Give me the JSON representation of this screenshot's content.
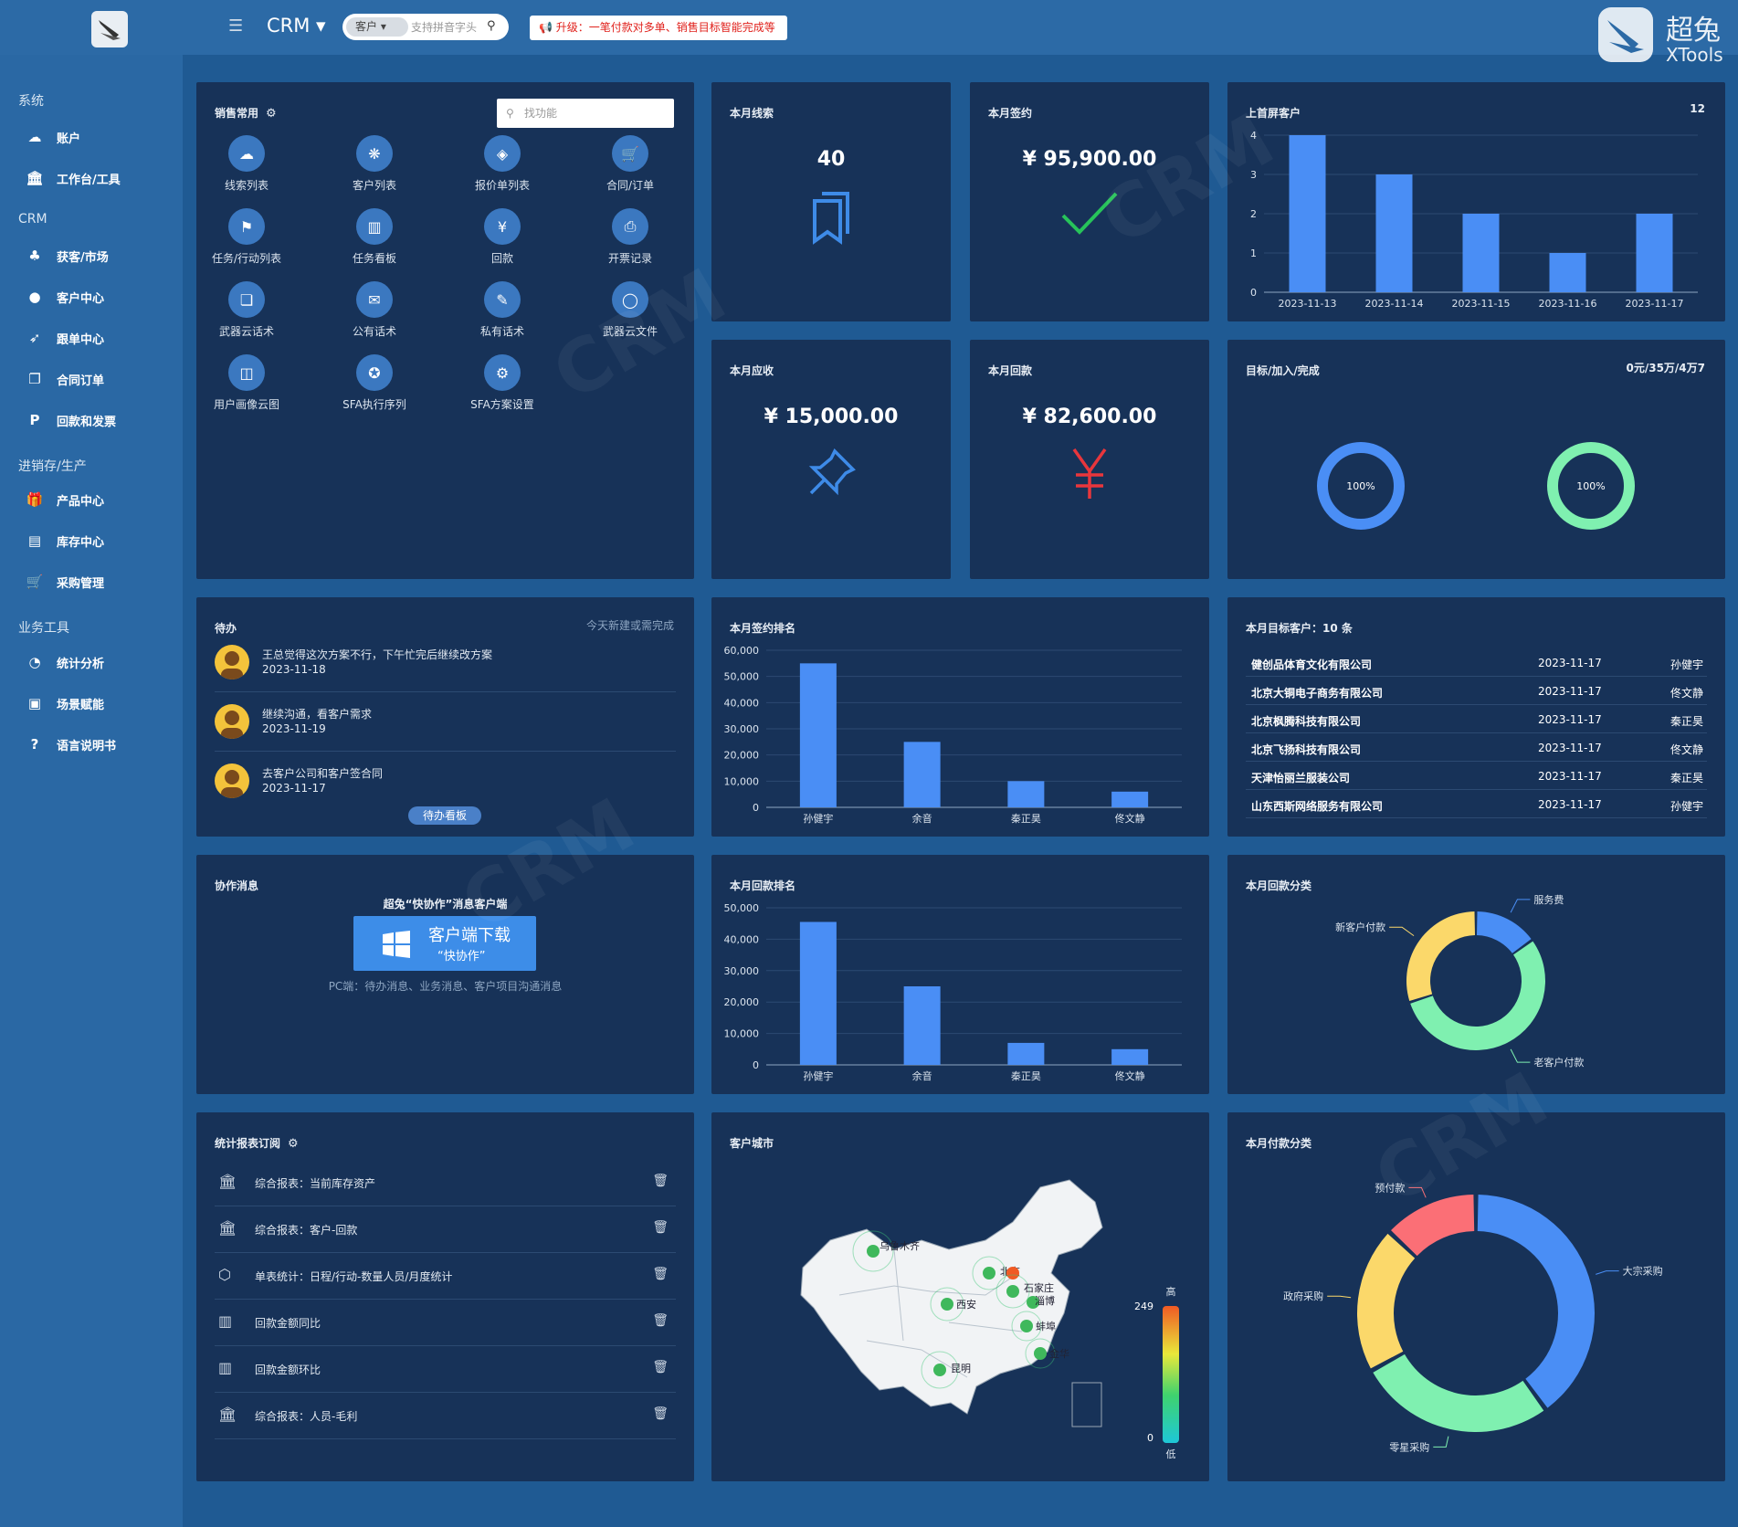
{
  "topbar": {
    "app_title": "CRM ▾",
    "search_scope": "客户 ▾",
    "search_placeholder": "支持拼音字头",
    "promo_text": "📢 升级：一笔付款对多单、销售目标智能完成等",
    "brand_cn": "超兔",
    "brand_en": "XTools"
  },
  "sidebar": {
    "sections": [
      {
        "title": "系统",
        "items": [
          {
            "label": "账户",
            "icon": "cloud-icon"
          },
          {
            "label": "工作台/工具",
            "icon": "bank-icon"
          }
        ]
      },
      {
        "title": "CRM",
        "items": [
          {
            "label": "获客/市场",
            "icon": "tree-icon"
          },
          {
            "label": "客户中心",
            "icon": "user-icon"
          },
          {
            "label": "跟单中心",
            "icon": "rocket-icon"
          },
          {
            "label": "合同订单",
            "icon": "copy-icon"
          },
          {
            "label": "回款和发票",
            "icon": "parking-icon"
          }
        ]
      },
      {
        "title": "进销存/生产",
        "items": [
          {
            "label": "产品中心",
            "icon": "gift-icon"
          },
          {
            "label": "库存中心",
            "icon": "warehouse-icon"
          },
          {
            "label": "采购管理",
            "icon": "cart-icon"
          }
        ]
      },
      {
        "title": "业务工具",
        "items": [
          {
            "label": "统计分析",
            "icon": "pie-icon"
          },
          {
            "label": "场景赋能",
            "icon": "scene-icon"
          },
          {
            "label": "语言说明书",
            "icon": "help-icon"
          }
        ]
      }
    ]
  },
  "sales_common": {
    "title": "销售常用",
    "search_placeholder": "找功能",
    "items": [
      {
        "label": "线索列表",
        "icon": "cloud-search-icon"
      },
      {
        "label": "客户列表",
        "icon": "group-icon"
      },
      {
        "label": "报价单列表",
        "icon": "tag-icon"
      },
      {
        "label": "合同/订单",
        "icon": "cart-icon"
      },
      {
        "label": "任务/行动列表",
        "icon": "flag-icon"
      },
      {
        "label": "任务看板",
        "icon": "board-icon"
      },
      {
        "label": "回款",
        "icon": "yen-icon"
      },
      {
        "label": "开票记录",
        "icon": "printer-icon"
      },
      {
        "label": "武器云话术",
        "icon": "bookmark-icon"
      },
      {
        "label": "公有话术",
        "icon": "chat-icon"
      },
      {
        "label": "私有话术",
        "icon": "chat-lock-icon"
      },
      {
        "label": "武器云文件",
        "icon": "bubble-icon"
      },
      {
        "label": "用户画像云图",
        "icon": "book-icon"
      },
      {
        "label": "SFA执行序列",
        "icon": "person-icon"
      },
      {
        "label": "SFA方案设置",
        "icon": "gear-icon"
      }
    ]
  },
  "kpis": {
    "leads": {
      "title": "本月线索",
      "value": "40"
    },
    "signed": {
      "title": "本月签约",
      "value": "¥ 95,900.00"
    },
    "receivable": {
      "title": "本月应收",
      "value": "¥ 15,000.00"
    },
    "received": {
      "title": "本月回款",
      "value": "¥ 82,600.00"
    }
  },
  "new_customers": {
    "title": "上首屏客户",
    "count": "12",
    "chart_data": {
      "type": "bar",
      "categories": [
        "2023-11-13",
        "2023-11-14",
        "2023-11-15",
        "2023-11-16",
        "2023-11-17"
      ],
      "values": [
        4,
        3,
        2,
        1,
        2
      ],
      "ylim": [
        0,
        4
      ],
      "yticks": [
        "0",
        "1",
        "2",
        "3",
        "4"
      ]
    }
  },
  "targets": {
    "title": "目标/加入/完成",
    "summary": "0元/35万/4万7",
    "ring1": {
      "label": "100%",
      "value": 100,
      "color": "#4a8ef5"
    },
    "ring2": {
      "label": "100%",
      "value": 100,
      "color": "#7ff0b0"
    }
  },
  "todo": {
    "title": "待办",
    "hint": "今天新建或需完成",
    "items": [
      {
        "text": "王总觉得这次方案不行，下午忙完后继续改方案",
        "date": "2023-11-18"
      },
      {
        "text": "继续沟通，看客户需求",
        "date": "2023-11-19"
      },
      {
        "text": "去客户公司和客户签合同",
        "date": "2023-11-17"
      }
    ],
    "button": "待办看板"
  },
  "sign_rank": {
    "title": "本月签约排名",
    "chart_data": {
      "type": "bar",
      "categories": [
        "孙健宇",
        "余音",
        "秦正昊",
        "佟文静"
      ],
      "values": [
        55000,
        25000,
        10000,
        6000
      ],
      "ylim": [
        0,
        60000
      ],
      "yticks": [
        "0",
        "10,000",
        "20,000",
        "30,000",
        "40,000",
        "50,000",
        "60,000"
      ]
    }
  },
  "target_customers": {
    "title": "本月目标客户：10 条",
    "rows": [
      {
        "name": "健创品体育文化有限公司",
        "date": "2023-11-17",
        "owner": "孙健宇"
      },
      {
        "name": "北京大铜电子商务有限公司",
        "date": "2023-11-17",
        "owner": "佟文静"
      },
      {
        "name": "北京枫腾科技有限公司",
        "date": "2023-11-17",
        "owner": "秦正昊"
      },
      {
        "name": "北京飞扬科技有限公司",
        "date": "2023-11-17",
        "owner": "佟文静"
      },
      {
        "name": "天津怡丽兰服装公司",
        "date": "2023-11-17",
        "owner": "秦正昊"
      },
      {
        "name": "山东西斯网络服务有限公司",
        "date": "2023-11-17",
        "owner": "孙健宇"
      }
    ]
  },
  "collab": {
    "title": "协作消息",
    "heading": "超兔“快协作”消息客户端",
    "btn_line1": "客户端下载",
    "btn_line2": "“快协作”",
    "desc": "PC端：待办消息、业务消息、客户项目沟通消息"
  },
  "payment_rank": {
    "title": "本月回款排名",
    "chart_data": {
      "type": "bar",
      "categories": [
        "孙健宇",
        "余音",
        "秦正昊",
        "佟文静"
      ],
      "values": [
        45500,
        25000,
        7000,
        5000
      ],
      "ylim": [
        0,
        50000
      ],
      "yticks": [
        "0",
        "10,000",
        "20,000",
        "30,000",
        "40,000",
        "50,000"
      ]
    }
  },
  "payment_category": {
    "title": "本月回款分类",
    "chart_data": {
      "type": "pie",
      "labels": [
        "服务费",
        "老客户付款",
        "新客户付款"
      ],
      "values": [
        15,
        55,
        30
      ],
      "colors": [
        "#4a8ef5",
        "#7ff0b0",
        "#fbd86a"
      ]
    }
  },
  "reports": {
    "title": "统计报表订阅",
    "items": [
      {
        "label": "综合报表：当前库存资产",
        "icon": "bank-icon"
      },
      {
        "label": "综合报表：客户-回款",
        "icon": "bank-icon"
      },
      {
        "label": "单表统计：日程/行动-数量人员/月度统计",
        "icon": "cube-icon"
      },
      {
        "label": "回款金额同比",
        "icon": "bar-chart-icon"
      },
      {
        "label": "回款金额环比",
        "icon": "bar-chart-icon"
      },
      {
        "label": "综合报表：人员-毛利",
        "icon": "bank-icon"
      }
    ]
  },
  "customer_city": {
    "title": "客户城市",
    "legend_max": "249",
    "legend_min": "0",
    "legend_high": "高",
    "legend_low": "低",
    "cities": [
      {
        "name": "乌鲁木齐"
      },
      {
        "name": "西安"
      },
      {
        "name": "北京"
      },
      {
        "name": "石家庄"
      },
      {
        "name": "淄博"
      },
      {
        "name": "蚌埠"
      },
      {
        "name": "金华"
      },
      {
        "name": "昆明"
      }
    ]
  },
  "pay_type": {
    "title": "本月付款分类",
    "chart_data": {
      "type": "pie",
      "labels": [
        "大宗采购",
        "零星采购",
        "政府采购",
        "预付款"
      ],
      "values": [
        40,
        27,
        20,
        13
      ],
      "colors": [
        "#4a8ef5",
        "#7ff0b0",
        "#fbd86a",
        "#fb6f76"
      ]
    }
  }
}
